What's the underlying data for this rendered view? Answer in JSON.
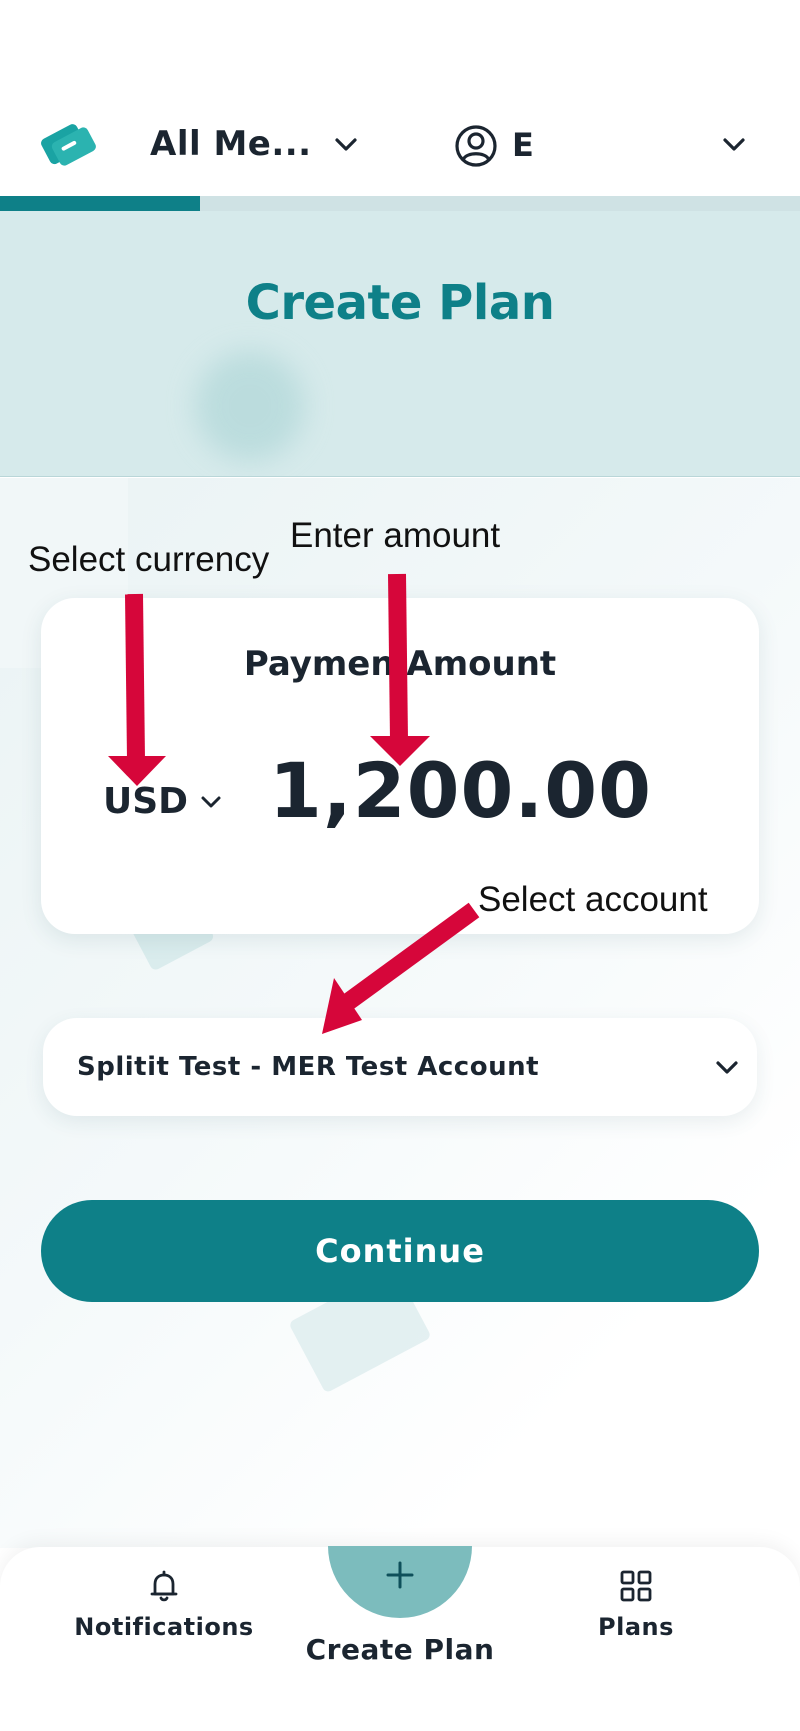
{
  "header": {
    "merchant_label": "All Me...",
    "user_initial": "E",
    "progress": 0.25
  },
  "hero": {
    "title": "Create Plan"
  },
  "payment": {
    "label": "Paymen Amount",
    "currency": "USD",
    "amount": "1,200.00"
  },
  "account": {
    "selected": "Splitit Test - MER Test Account"
  },
  "actions": {
    "continue_label": "Continue"
  },
  "annotations": {
    "currency_note": "Select currency",
    "amount_note": "Enter amount",
    "account_note": "Select account",
    "arrow_color": "#d6063a"
  },
  "bottom_nav": {
    "notifications_label": "Notifications",
    "create_label": "Create Plan",
    "plans_label": "Plans"
  },
  "icons": {
    "logo": "splitit-logo-icon",
    "user": "user-circle-icon",
    "chevron": "chevron-down-icon",
    "bell": "bell-icon",
    "plus": "plus-icon",
    "grid": "grid-icon"
  },
  "colors": {
    "brand": "#0e8088",
    "hero_bg": "#d6eaeb",
    "text": "#1b2530"
  }
}
